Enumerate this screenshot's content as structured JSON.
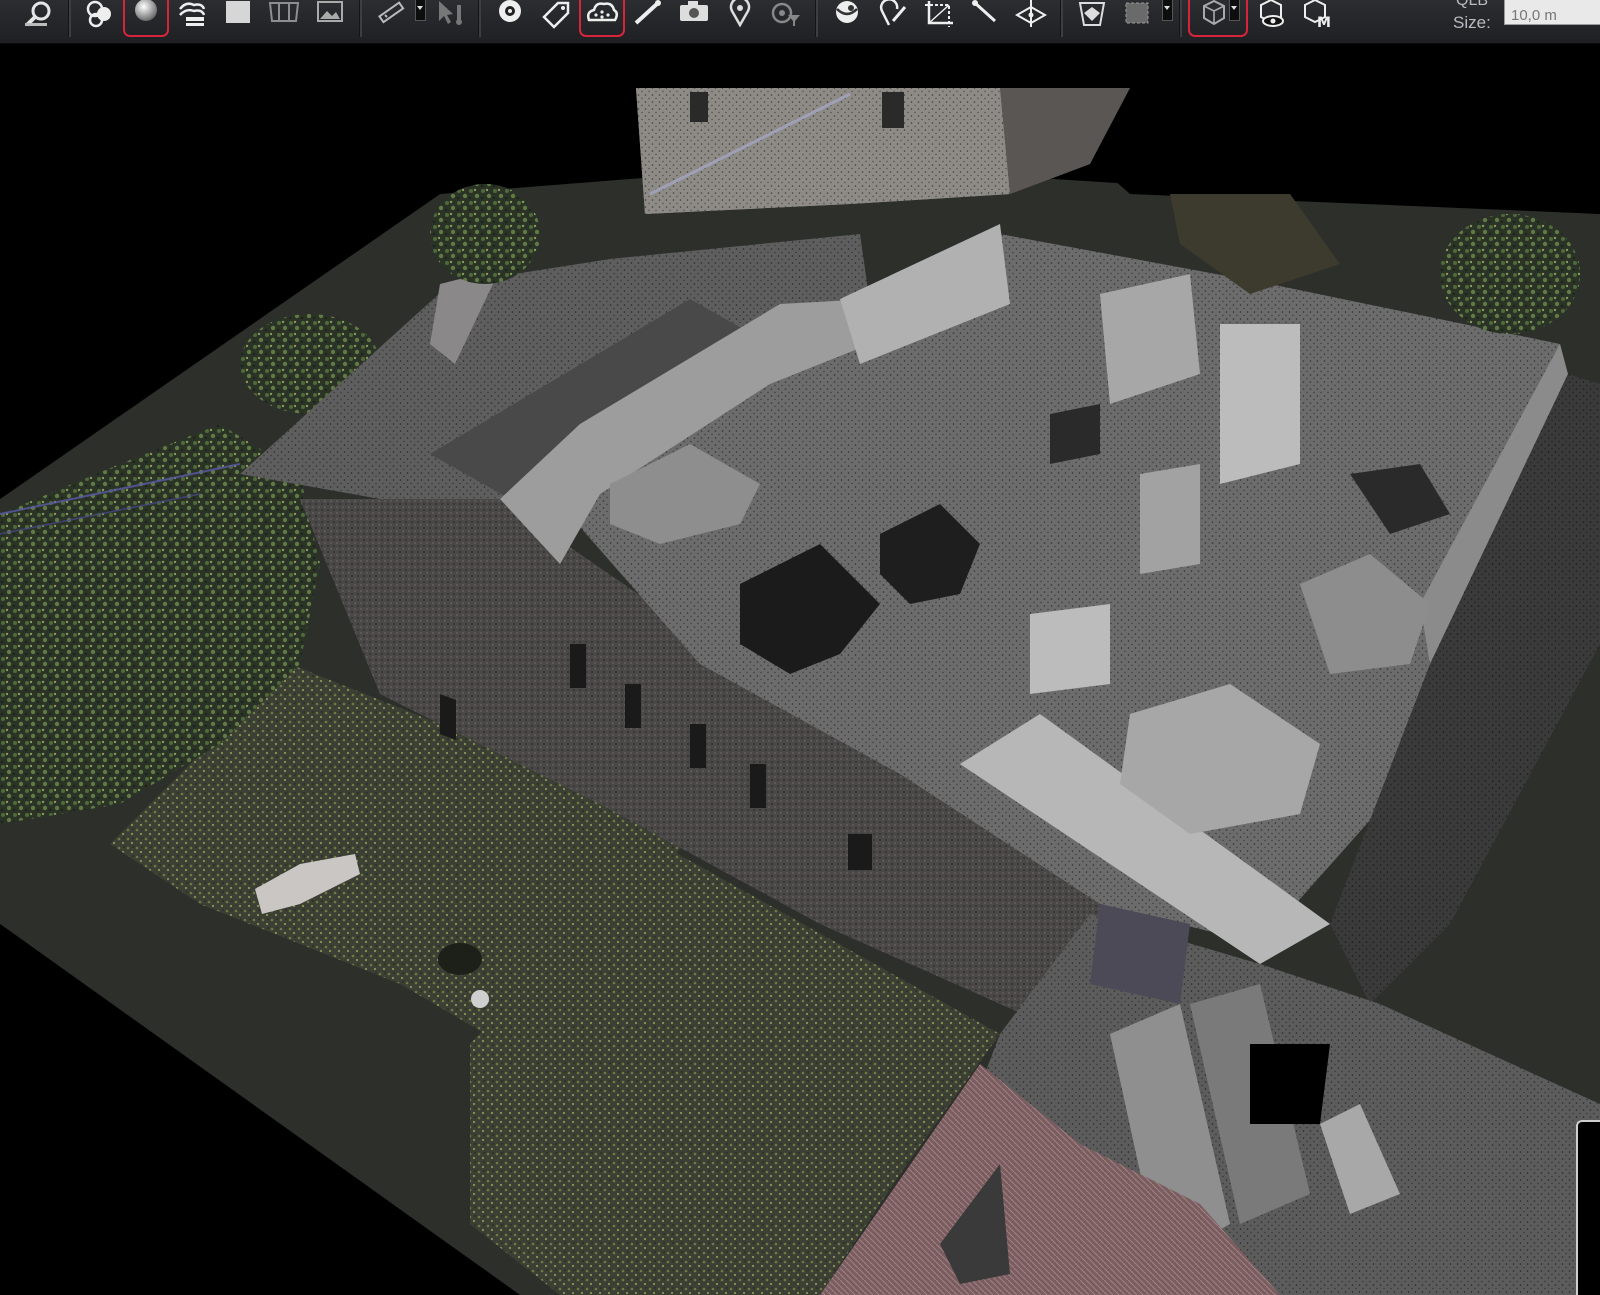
{
  "toolbar": {
    "buttons": [
      {
        "id": "zoom",
        "icon": "magnifier-zoom-icon"
      },
      {
        "id": "point-cloud-mode",
        "icon": "circles-cluster-icon"
      },
      {
        "id": "shading",
        "icon": "sphere-shading-icon",
        "active": true
      },
      {
        "id": "layers",
        "icon": "layers-stack-icon"
      },
      {
        "id": "solid-view",
        "icon": "square-solid-icon"
      },
      {
        "id": "panorama",
        "icon": "panorama-frame-icon"
      },
      {
        "id": "image",
        "icon": "image-icon"
      },
      {
        "id": "measure",
        "icon": "ruler-pencil-icon",
        "dropdown": true
      },
      {
        "id": "select-pointer",
        "icon": "cursor-thermometer-icon"
      },
      {
        "id": "target",
        "icon": "target-disc-icon"
      },
      {
        "id": "tag",
        "icon": "tag-label-icon"
      },
      {
        "id": "cloud-mesh",
        "icon": "cloud-mesh-icon",
        "active": true
      },
      {
        "id": "line-tool",
        "icon": "line-draw-icon"
      },
      {
        "id": "camera",
        "icon": "camera-icon"
      },
      {
        "id": "placemark",
        "icon": "map-pin-icon"
      },
      {
        "id": "point-filter",
        "icon": "filter-points-icon"
      },
      {
        "id": "sphere-scan",
        "icon": "scan-globe-icon"
      },
      {
        "id": "pin-edit",
        "icon": "pin-edit-icon"
      },
      {
        "id": "crop",
        "icon": "crop-axes-icon"
      },
      {
        "id": "wand",
        "icon": "wand-icon"
      },
      {
        "id": "plane-section",
        "icon": "plane-section-icon"
      },
      {
        "id": "perspective",
        "icon": "perspective-view-icon"
      },
      {
        "id": "clip-box",
        "icon": "clip-box-icon",
        "dropdown": true
      },
      {
        "id": "cube-view",
        "icon": "wire-cube-icon",
        "active": true,
        "dropdown": true
      },
      {
        "id": "cube-visibility",
        "icon": "cube-eye-icon"
      },
      {
        "id": "cube-measure",
        "icon": "cube-m-icon"
      }
    ],
    "qlb_label": "QLB",
    "size_label": "Size:",
    "size_value": "10,0 m"
  },
  "colors": {
    "toolbar_bg": "#25272a",
    "active_outline": "#d6243c",
    "viewport_bg": "#000000",
    "size_field_bg": "#e9e9e9"
  }
}
